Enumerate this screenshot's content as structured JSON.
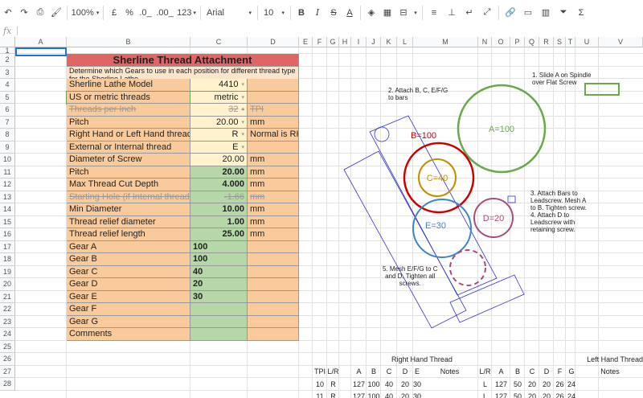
{
  "toolbar": {
    "zoom": "100%",
    "currency": "£",
    "percent": "%",
    "dec_less": ".0_",
    "dec_more": ".00_",
    "more_formats": "123",
    "font": "Arial",
    "font_size": "10"
  },
  "formula_bar": {
    "fx": "fx",
    "value": ""
  },
  "columns": [
    "A",
    "B",
    "C",
    "D",
    "E",
    "F",
    "G",
    "H",
    "I",
    "J",
    "K",
    "L",
    "M",
    "N",
    "O",
    "P",
    "Q",
    "R",
    "S",
    "T",
    "U",
    "V"
  ],
  "rows": [
    "1",
    "2",
    "3",
    "4",
    "5",
    "6",
    "7",
    "8",
    "9",
    "10",
    "11",
    "12",
    "13",
    "14",
    "15",
    "16",
    "17",
    "18",
    "19",
    "20",
    "21",
    "22",
    "23",
    "24",
    "25",
    "26",
    "27",
    "28"
  ],
  "sheet": {
    "title": "Sherline Thread Attachment",
    "description": "Determine which Gears to use in each position for different thread type for the Sherline Lathe",
    "inputs": [
      {
        "label": "Sherline Lathe Model",
        "value": "4410",
        "unit": "",
        "dropdown": true,
        "style": "input"
      },
      {
        "label": "US or metric threads",
        "value": "metric",
        "unit": "",
        "dropdown": true,
        "style": "input"
      },
      {
        "label": "Threads per Inch",
        "value": "32",
        "unit": "TPI",
        "dropdown": true,
        "style": "disabled"
      },
      {
        "label": "Pitch",
        "value": "20.00",
        "unit": "mm",
        "dropdown": true,
        "style": "input"
      },
      {
        "label": "Right Hand or Left Hand threads",
        "value": "R",
        "unit": "Normal is RH",
        "dropdown": true,
        "style": "input"
      },
      {
        "label": "External or Internal thread",
        "value": "E",
        "unit": "",
        "dropdown": true,
        "style": "input"
      },
      {
        "label": "Diameter of Screw",
        "value": "20.00",
        "unit": "mm",
        "dropdown": false,
        "style": "input"
      }
    ],
    "outputs": [
      {
        "label": "Pitch",
        "value": "20.00",
        "unit": "mm",
        "align": "right",
        "style": "normal"
      },
      {
        "label": "Max Thread Cut Depth",
        "value": "4.000",
        "unit": "mm",
        "align": "right",
        "style": "normal"
      },
      {
        "label": "Starting Hole (if Internal thread)",
        "value": "-1.66",
        "unit": "mm",
        "align": "right",
        "style": "disabled"
      },
      {
        "label": "Min Diameter",
        "value": "10.00",
        "unit": "mm",
        "align": "right",
        "style": "normal"
      },
      {
        "label": "Thread relief diameter",
        "value": "1.00",
        "unit": "mm",
        "align": "right",
        "style": "normal"
      },
      {
        "label": "Thread relief length",
        "value": "25.00",
        "unit": "mm",
        "align": "right",
        "style": "normal"
      },
      {
        "label": "Gear A",
        "value": "100",
        "unit": "",
        "align": "left",
        "style": "normal"
      },
      {
        "label": "Gear B",
        "value": "100",
        "unit": "",
        "align": "left",
        "style": "normal"
      },
      {
        "label": "Gear C",
        "value": "40",
        "unit": "",
        "align": "left",
        "style": "normal"
      },
      {
        "label": "Gear D",
        "value": "20",
        "unit": "",
        "align": "left",
        "style": "normal"
      },
      {
        "label": "Gear E",
        "value": "30",
        "unit": "",
        "align": "left",
        "style": "normal"
      },
      {
        "label": "Gear F",
        "value": "",
        "unit": "",
        "align": "left",
        "style": "normal"
      },
      {
        "label": "Gear G",
        "value": "",
        "unit": "",
        "align": "left",
        "style": "normal"
      },
      {
        "label": "Comments",
        "value": "",
        "unit": "",
        "align": "left",
        "style": "normal"
      }
    ]
  },
  "diagram": {
    "notes": [
      [
        "1. Slide A on Spindle",
        "over Flat Screw"
      ],
      [
        "2. Attach B, C, E/F/G",
        "to bars"
      ],
      [
        "3. Attach Bars to",
        "Leadscrew. Mesh A",
        "to B. Tighten screw.",
        "4. Attach D to",
        "Leadscrew with",
        "retaining screw."
      ],
      [
        "5. Mesh E/F/G to C",
        "and D. Tighten all",
        "screws."
      ]
    ],
    "gears": [
      {
        "label": "A=100",
        "color": "#6aa84f"
      },
      {
        "label": "B=100",
        "color": "#cc0000"
      },
      {
        "label": "C=40",
        "color": "#bf9000"
      },
      {
        "label": "D=20",
        "color": "#a64d79"
      },
      {
        "label": "E=30",
        "color": "#3d85c6"
      }
    ]
  },
  "lookup": {
    "right_title": "Right Hand Thread",
    "left_title": "Left Hand Thread",
    "right_headers": [
      "TPI",
      "L/R",
      "A",
      "B",
      "C",
      "D",
      "E",
      "Notes"
    ],
    "left_headers": [
      "L/R",
      "A",
      "B",
      "C",
      "D",
      "F",
      "G",
      "Notes"
    ],
    "rows": [
      {
        "right": [
          "10",
          "R",
          "127",
          "100",
          "40",
          "20",
          "30",
          ""
        ],
        "left": [
          "L",
          "127",
          "50",
          "20",
          "20",
          "26",
          "24",
          ""
        ]
      },
      {
        "right": [
          "11",
          "R",
          "127",
          "100",
          "40",
          "20",
          "30",
          ""
        ],
        "left": [
          "L",
          "127",
          "50",
          "20",
          "20",
          "26",
          "24",
          ""
        ]
      }
    ]
  },
  "colors": {
    "title_bg": "#e06666",
    "label_bg": "#f9cb9c",
    "input_bg": "#fff2cc",
    "output_bg": "#b6d7a8",
    "description_bg": "#fce5cd",
    "selection": "#1a73e8"
  }
}
